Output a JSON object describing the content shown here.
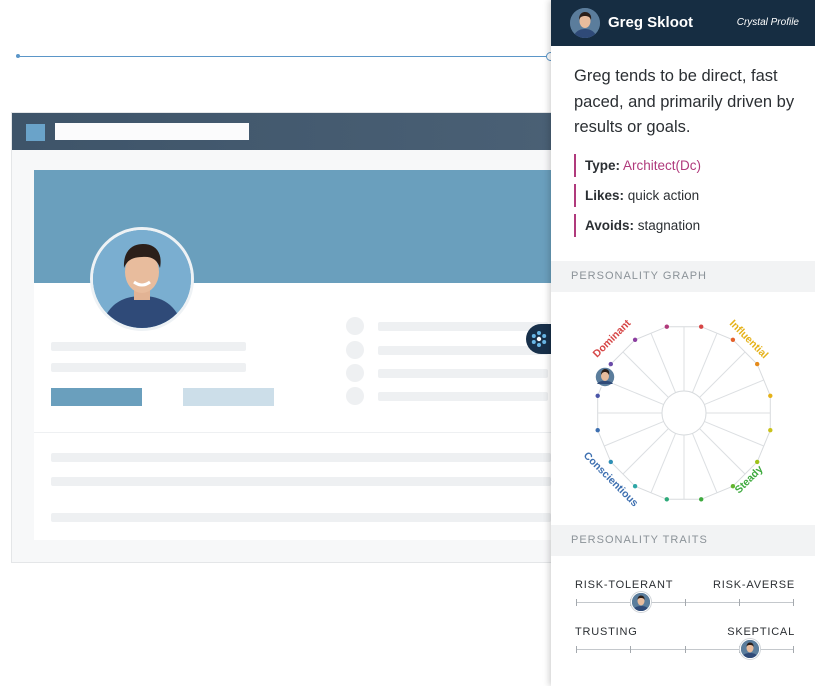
{
  "panel": {
    "name": "Greg Skloot",
    "brand": "Crystal Profile",
    "summary": "Greg tends to be direct, fast paced, and primarily driven by results or goals.",
    "facts": [
      {
        "label": "Type:",
        "value": "Architect(Dc)"
      },
      {
        "label": "Likes:",
        "value": "quick action"
      },
      {
        "label": "Avoids:",
        "value": "stagnation"
      }
    ],
    "sections": {
      "graph": "PERSONALITY GRAPH",
      "traits": "PERSONALITY TRAITS"
    },
    "graph_labels": {
      "dominant": "Dominant",
      "influential": "Influential",
      "steady": "Steady",
      "conscientious": "Conscientious"
    },
    "traits": [
      {
        "left": "RISK-TOLERANT",
        "right": "RISK-AVERSE",
        "position": 0.3
      },
      {
        "left": "TRUSTING",
        "right": "SKEPTICAL",
        "position": 0.8
      }
    ]
  },
  "icons": {
    "toggle": "crystal-logo-icon",
    "avatar": "user-avatar-icon"
  },
  "colors": {
    "header": "#162d42",
    "accent": "#b03a7c",
    "mock_blue": "#6a9fbd"
  }
}
